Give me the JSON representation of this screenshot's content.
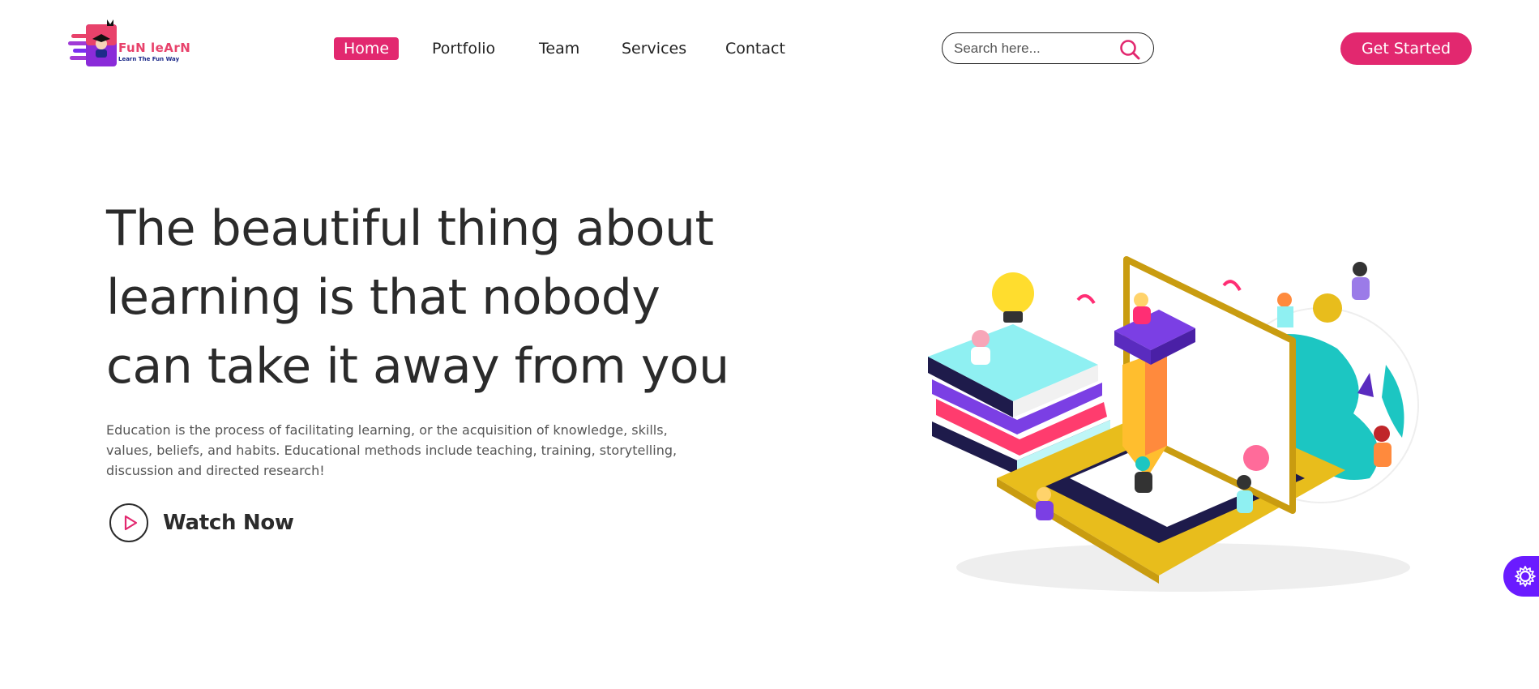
{
  "brand": {
    "name": "FuN leArN",
    "tagline": "Learn The Fun Way"
  },
  "nav": {
    "items": [
      {
        "label": "Home",
        "active": true
      },
      {
        "label": "Portfolio",
        "active": false
      },
      {
        "label": "Team",
        "active": false
      },
      {
        "label": "Services",
        "active": false
      },
      {
        "label": "Contact",
        "active": false
      }
    ]
  },
  "search": {
    "placeholder": "Search here...",
    "icon": "search-icon"
  },
  "header": {
    "cta_label": "Get Started"
  },
  "hero": {
    "title_lines": [
      "The beautiful thing about",
      "learning is that nobody",
      "can take it away from you"
    ],
    "description": "Education is the process of facilitating learning, or the acquisition of knowledge, skills, values, beliefs, and habits. Educational methods include teaching, training, storytelling, discussion and directed research!",
    "watch_label": "Watch Now"
  },
  "colors": {
    "accent": "#e2286f",
    "settings": "#6a1bff",
    "text": "#2b2b2b"
  }
}
